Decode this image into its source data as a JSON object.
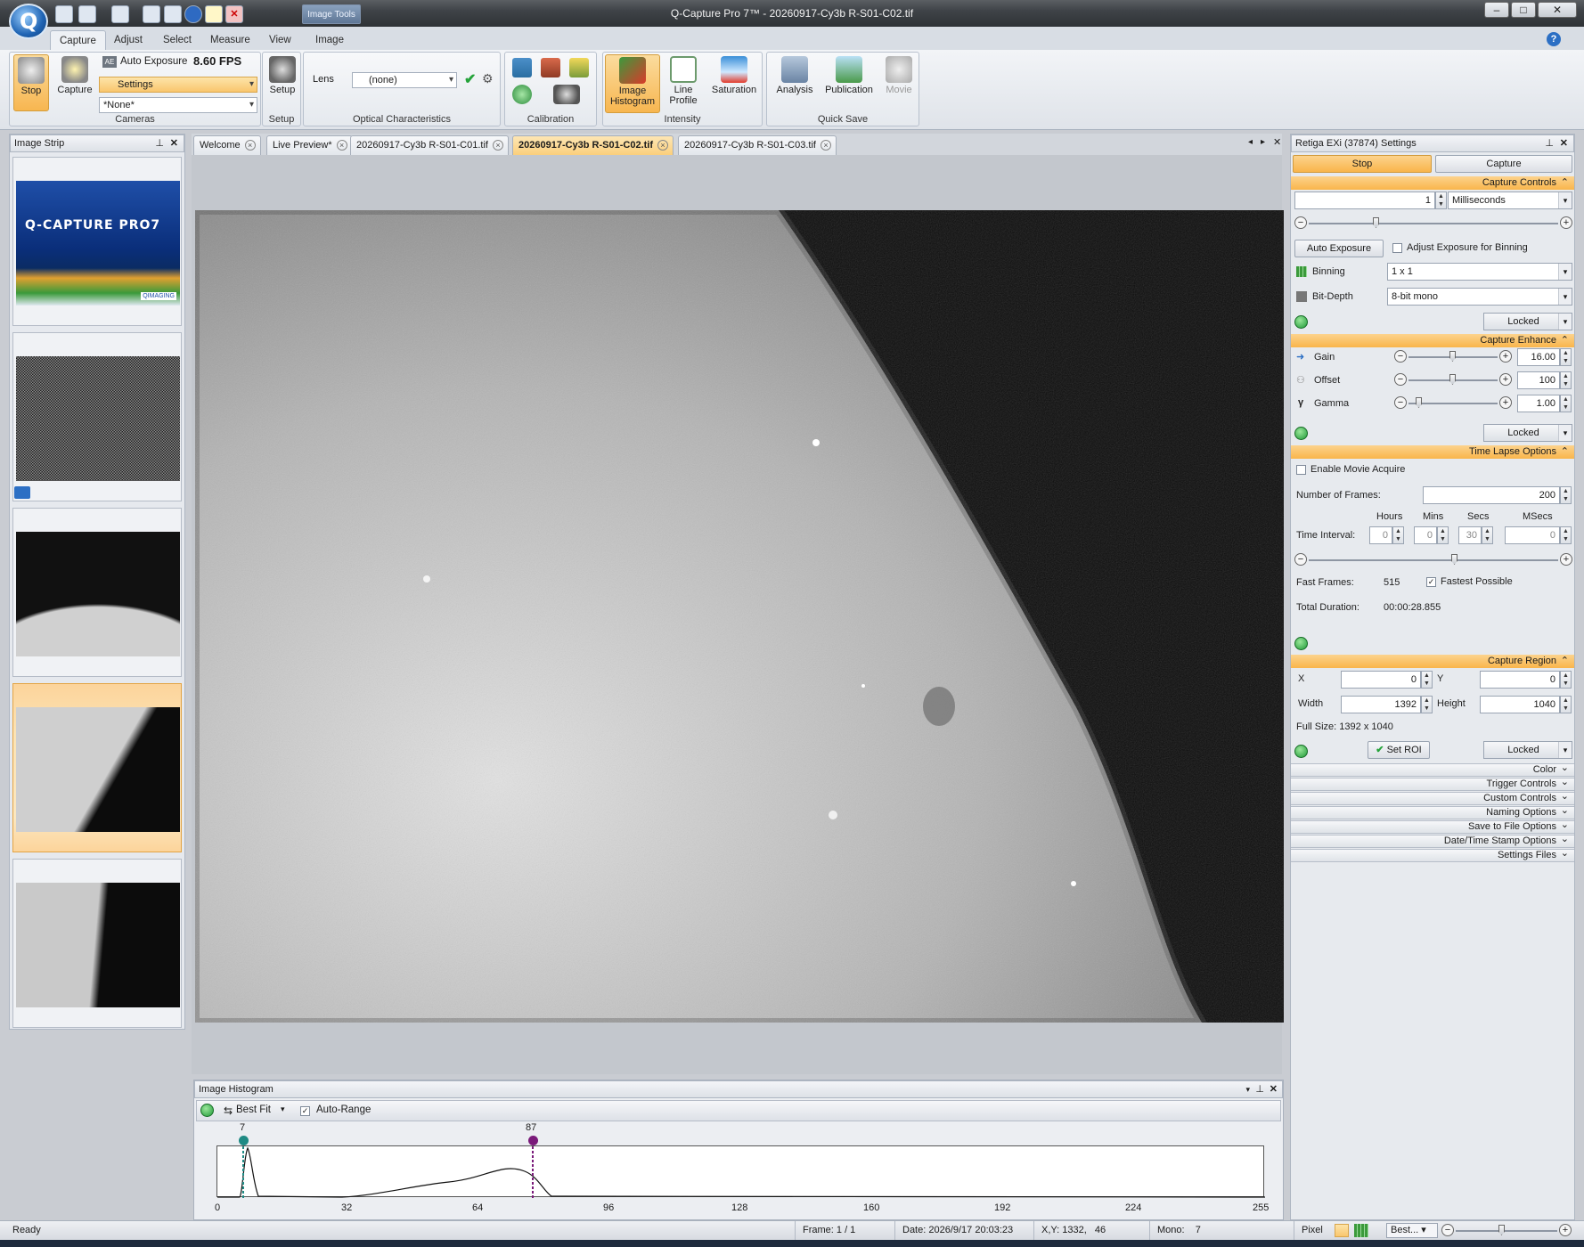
{
  "window": {
    "title": "Q-Capture Pro 7™ - 20260917-Cy3b R-S01-C02.tif"
  },
  "image_tools_label": "Image Tools",
  "ribbon_tabs": [
    "Capture",
    "Adjust",
    "Select",
    "Measure",
    "View",
    "Image"
  ],
  "ribbon": {
    "cameras": {
      "stop": "Stop",
      "capture": "Capture",
      "auto_exposure": "Auto Exposure",
      "fps": "8.60 FPS",
      "settings": "Settings",
      "none": "*None*",
      "label": "Cameras"
    },
    "setup": {
      "button": "Setup",
      "label": "Setup"
    },
    "optical": {
      "lens_label": "Lens",
      "lens_value": "(none)",
      "label": "Optical Characteristics"
    },
    "calibration": {
      "label": "Calibration"
    },
    "intensity": {
      "image_histogram": "Image Histogram",
      "line_profile": "Line Profile",
      "saturation": "Saturation",
      "label": "Intensity"
    },
    "quick_save": {
      "analysis": "Analysis",
      "publication": "Publication",
      "movie": "Movie",
      "label": "Quick Save"
    }
  },
  "image_strip": {
    "title": "Image Strip",
    "banner_title": "Q-CAPTURE PRO7",
    "banner_brand": "QIMAGING"
  },
  "doc_tabs": [
    {
      "label": "Welcome",
      "active": false
    },
    {
      "label": "Live Preview*",
      "active": false
    },
    {
      "label": "20260917-Cy3b R-S01-C01.tif",
      "active": false
    },
    {
      "label": "20260917-Cy3b R-S01-C02.tif",
      "active": true
    },
    {
      "label": "20260917-Cy3b R-S01-C03.tif",
      "active": false
    }
  ],
  "histogram": {
    "title": "Image Histogram",
    "best_fit": "Best Fit",
    "auto_range": "Auto-Range",
    "auto_range_checked": true,
    "low_marker": "7",
    "high_marker": "87",
    "ticks": [
      "0",
      "32",
      "64",
      "96",
      "128",
      "160",
      "192",
      "224",
      "255"
    ]
  },
  "settings": {
    "title": "Retiga EXi (37874) Settings",
    "stop_tab": "Stop",
    "capture_tab": "Capture",
    "capture_controls": {
      "header": "Capture Controls",
      "exposure_value": "1",
      "exposure_unit": "Milliseconds",
      "auto_exposure": "Auto Exposure",
      "adjust_binning": "Adjust Exposure for Binning",
      "binning_label": "Binning",
      "binning_value": "1 x 1",
      "bitdepth_label": "Bit-Depth",
      "bitdepth_value": "8-bit mono",
      "locked": "Locked"
    },
    "capture_enhance": {
      "header": "Capture Enhance",
      "gain_label": "Gain",
      "gain_value": "16.00",
      "offset_label": "Offset",
      "offset_value": "100",
      "gamma_label": "Gamma",
      "gamma_value": "1.00",
      "locked": "Locked"
    },
    "time_lapse": {
      "header": "Time Lapse Options",
      "enable_movie": "Enable Movie Acquire",
      "num_frames_label": "Number of  Frames:",
      "num_frames": "200",
      "hours": "Hours",
      "mins": "Mins",
      "secs": "Secs",
      "msecs": "MSecs",
      "time_interval": "Time Interval:",
      "hours_val": "0",
      "mins_val": "0",
      "secs_val": "30",
      "msecs_val": "0",
      "fast_frames_label": "Fast Frames:",
      "fast_frames": "515",
      "fastest_possible": "Fastest Possible",
      "total_duration_label": "Total Duration:",
      "total_duration": "00:00:28.855"
    },
    "capture_region": {
      "header": "Capture Region",
      "x_label": "X",
      "x_value": "0",
      "y_label": "Y",
      "y_value": "0",
      "width_label": "Width",
      "width_value": "1392",
      "height_label": "Height",
      "height_value": "1040",
      "full_size": "Full Size: 1392 x 1040",
      "set_roi": "Set ROI",
      "locked": "Locked"
    },
    "collapsed_sections": [
      "Color",
      "Trigger Controls",
      "Custom Controls",
      "Naming Options",
      "Save to File Options",
      "Date/Time Stamp Options",
      "Settings Files"
    ]
  },
  "status": {
    "ready": "Ready",
    "frame": "Frame: 1 / 1",
    "date": "Date: 2026/9/17 20:03:23",
    "xy": "X,Y: 1332,   46",
    "mono": "Mono:    7",
    "pixel": "Pixel",
    "zoom": "Best..."
  },
  "colors": {
    "accent_orange": "#f9b54b",
    "selected_tab": "#fbcf7c",
    "marker_low": "#1f8a84",
    "marker_high": "#7a1a7a"
  }
}
